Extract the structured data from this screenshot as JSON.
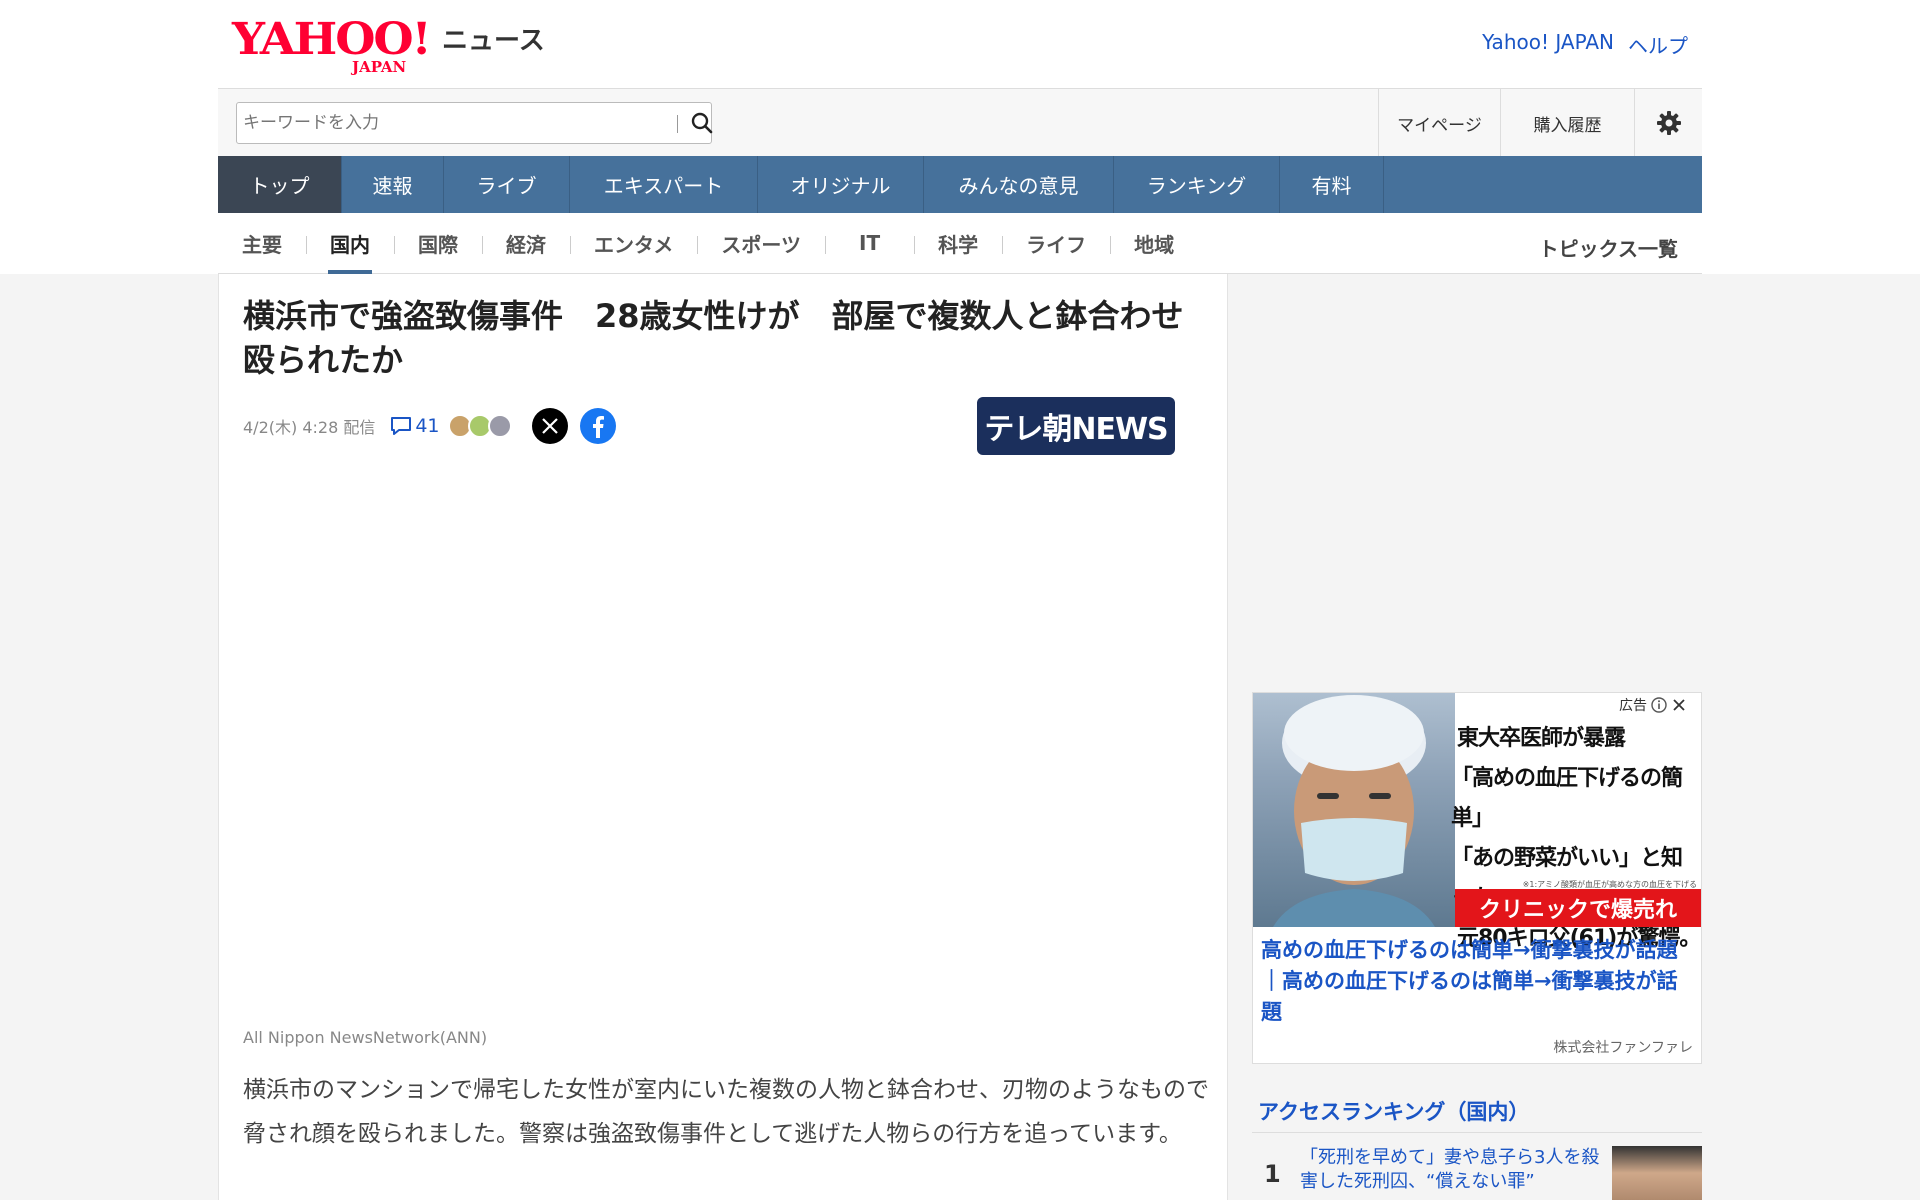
{
  "header": {
    "logo_text": "YAHOO!",
    "logo_sub": "JAPAN",
    "news_label": "ニュース",
    "links": [
      "Yahoo! JAPAN",
      "ヘルプ"
    ]
  },
  "search": {
    "placeholder": "キーワードを入力"
  },
  "user_links": {
    "mypage": "マイページ",
    "history": "購入履歴"
  },
  "nav_primary": [
    "トップ",
    "速報",
    "ライブ",
    "エキスパート",
    "オリジナル",
    "みんなの意見",
    "ランキング",
    "有料"
  ],
  "nav_secondary": [
    "主要",
    "国内",
    "国際",
    "経済",
    "エンタメ",
    "スポーツ",
    "IT",
    "科学",
    "ライフ",
    "地域"
  ],
  "nav_secondary_active": "国内",
  "topics_link": "トピックス一覧",
  "article": {
    "title": "横浜市で強盗致傷事件　28歳女性けが　部屋で複数人と鉢合わせ殴られたか",
    "date": "4/2(木) 4:28 配信",
    "comment_count": "41",
    "source": "テレ朝NEWS",
    "caption": "All Nippon NewsNetwork(ANN)",
    "body": "横浜市のマンションで帰宅した女性が室内にいた複数の人物と鉢合わせ、刃物のようなもので脅され顔を殴られました。警察は強盗致傷事件として逃げた人物らの行方を追っています。"
  },
  "ad": {
    "label": "広告",
    "headline_lines": [
      "東大卒医師が暴露",
      "「高めの血圧下げるの簡単」",
      "「あの野菜がいい」と知った",
      "元80キロ父(61)が驚愕。"
    ],
    "tiny_note": "※1:アミノ酸類が血圧が高めな方の血圧を下げる",
    "red_banner": "クリニックで爆売れ",
    "link_text": "高めの血圧下げるのは簡単→衝撃裏技が話題｜高めの血圧下げるのは簡単→衝撃裏技が話題",
    "company": "株式会社ファンファレ"
  },
  "ranking": {
    "title": "アクセスランキング（国内）",
    "items": [
      {
        "rank": "1",
        "text": "「死刑を早めて」妻や息子ら3人を殺害した死刑囚、“償えない罪”"
      }
    ]
  },
  "colors": {
    "nav_primary_bg": "#46719b",
    "nav_active_bg": "#3b4654",
    "link_blue": "#1a55c5",
    "logo_red": "#ff0033",
    "ad_red": "#e3151a"
  }
}
